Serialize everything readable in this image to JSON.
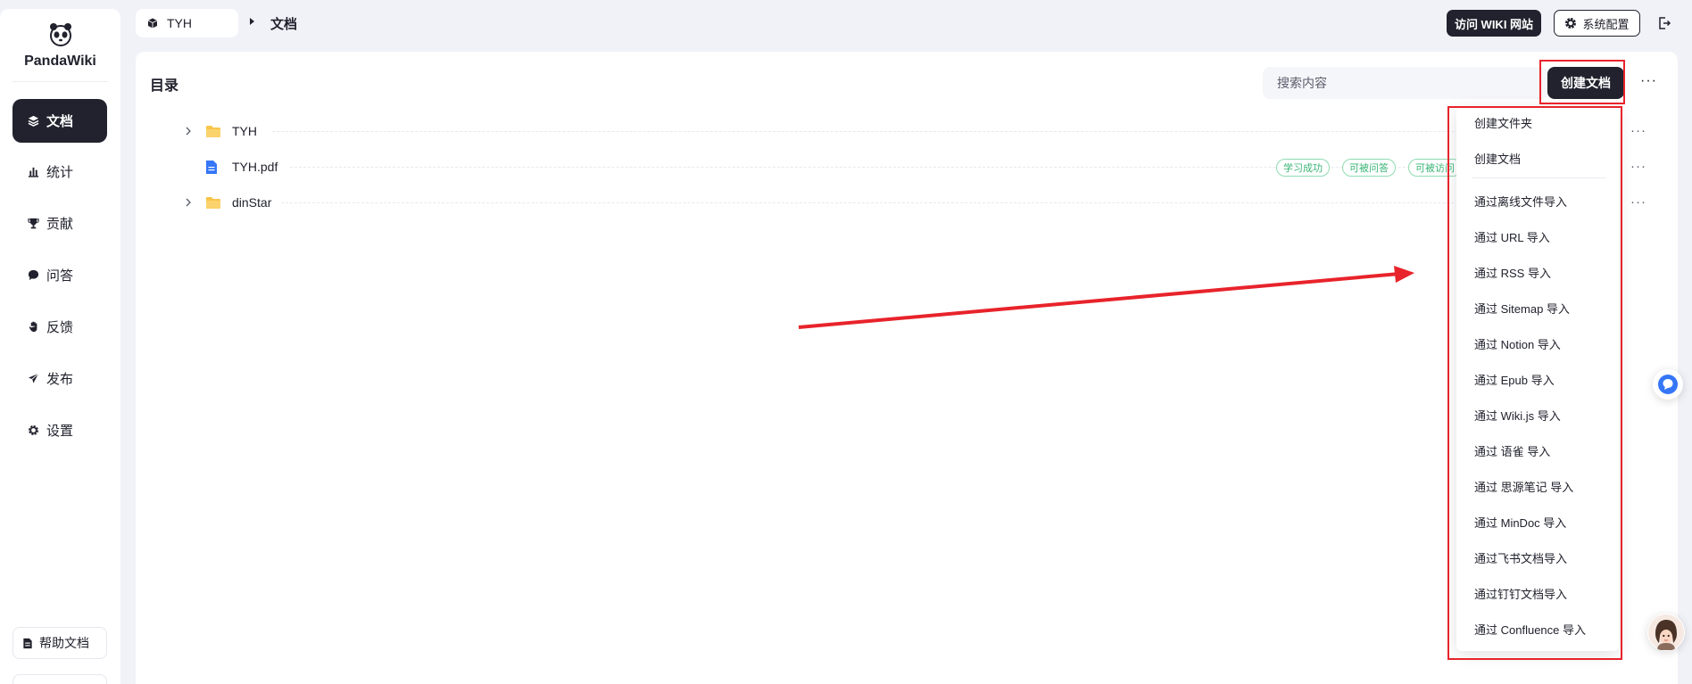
{
  "app": {
    "name": "PandaWiki"
  },
  "sidebar": {
    "items": [
      {
        "label": "文档",
        "icon": "layers-icon",
        "active": true
      },
      {
        "label": "统计",
        "icon": "bar-chart-icon"
      },
      {
        "label": "贡献",
        "icon": "trophy-icon"
      },
      {
        "label": "问答",
        "icon": "chat-bubble-icon"
      },
      {
        "label": "反馈",
        "icon": "hand-icon"
      },
      {
        "label": "发布",
        "icon": "send-icon"
      },
      {
        "label": "设置",
        "icon": "gear-icon"
      }
    ],
    "help_label": "帮助文档"
  },
  "header": {
    "kb_name": "TYH",
    "current_page": "文档",
    "visit_wiki_label": "访问 WIKI 网站",
    "system_config_label": "系统配置"
  },
  "main": {
    "title": "目录",
    "search_placeholder": "搜索内容",
    "create_label": "创建文档",
    "tree": [
      {
        "name": "TYH",
        "type": "folder",
        "expandable": true
      },
      {
        "name": "TYH.pdf",
        "type": "file",
        "tags": [
          "学习成功",
          "可被问答",
          "可被访问"
        ]
      },
      {
        "name": "dinStar",
        "type": "folder",
        "expandable": true
      }
    ]
  },
  "dropdown": {
    "items": [
      "创建文件夹",
      "创建文档",
      "通过离线文件导入",
      "通过 URL 导入",
      "通过 RSS 导入",
      "通过 Sitemap 导入",
      "通过 Notion 导入",
      "通过 Epub 导入",
      "通过 Wiki.js 导入",
      "通过 语雀 导入",
      "通过 思源笔记 导入",
      "通过 MinDoc 导入",
      "通过飞书文档导入",
      "通过钉钉文档导入",
      "通过 Confluence 导入"
    ]
  },
  "colors": {
    "primary_dark": "#21222d",
    "annotation_red": "#e8232b",
    "tag_green": "#3ab476",
    "folder_yellow": "#f9c54a",
    "file_blue": "#3476f6"
  }
}
